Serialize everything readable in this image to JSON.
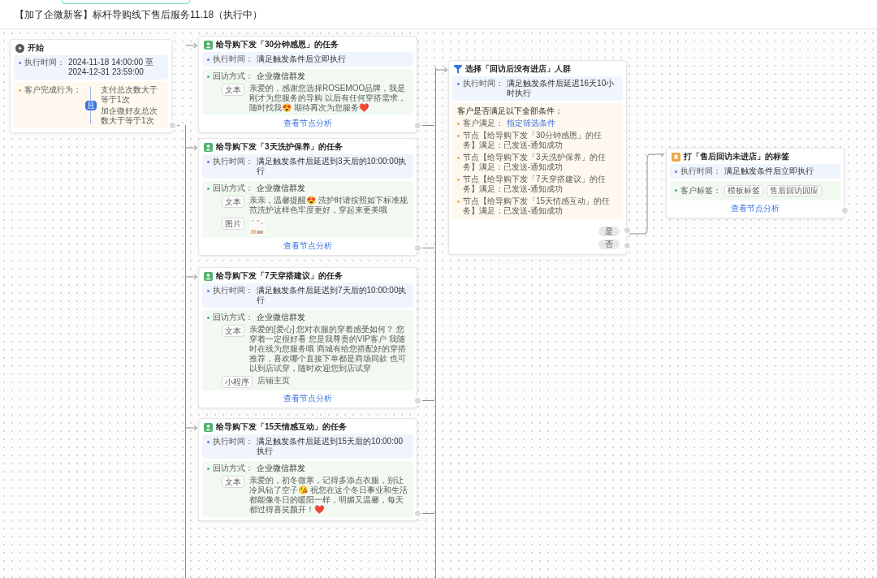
{
  "title": "【加了企微新客】标杆导购线下售后服务11.18（执行中）",
  "start": {
    "title": "开始",
    "exec_label": "执行时间：",
    "exec_value": "2024-11-18 14:00:00 至 2024-12-31 23:59:00",
    "behavior_label": "客户完成行为：",
    "logic": "且",
    "conditions": [
      "支付总次数大于等于1次",
      "加企微好友总次数大于等于1次"
    ]
  },
  "tasks": [
    {
      "title": "给导购下发「30分钟感恩」的任务",
      "exec_label": "执行时间：",
      "exec_value": "满足触发条件后立即执行",
      "method_label": "回访方式：",
      "method_value": "企业微信群发",
      "contents": [
        {
          "kind": "text",
          "label": "文本",
          "value": "亲爱的，感谢您选择ROSEMOO品牌，我是刚才为您服务的导购 以后有任何穿搭需求，随时找我😍 期待再次为您服务❤️"
        }
      ],
      "link": "查看节点分析"
    },
    {
      "title": "给导购下发「3天洗护保养」的任务",
      "exec_label": "执行时间：",
      "exec_value": "满足触发条件后延迟到3天后的10:00:00执行",
      "method_label": "回访方式：",
      "method_value": "企业微信群发",
      "contents": [
        {
          "kind": "text",
          "label": "文本",
          "value": "亲亲，温馨提醒😍 洗护时请按照如下标准规范洗护这样色牢度更好，穿起来更美哦"
        },
        {
          "label": "图片"
        }
      ],
      "link": "查看节点分析"
    },
    {
      "title": "给导购下发「7天穿搭建议」的任务",
      "exec_label": "执行时间：",
      "exec_value": "满足触发条件后延迟到7天后的10:00:00执行",
      "method_label": "回访方式：",
      "method_value": "企业微信群发",
      "contents": [
        {
          "kind": "text",
          "label": "文本",
          "value": "亲爱的[爱心] 您对衣服的穿着感受如何？ 您穿着一定很好看 您是我尊贵的VIP客户 我随时在线为您服务哦 商城有给您搭配好的穿搭推荐，喜欢哪个直接下单都是商场同款 也可以到店试穿，随时欢迎您到店试穿"
        },
        {
          "kind": "text",
          "label": "小程序",
          "value": "店铺主页"
        }
      ],
      "link": "查看节点分析"
    },
    {
      "title": "给导购下发「15天情感互动」的任务",
      "exec_label": "执行时间：",
      "exec_value": "满足触发条件后延迟到15天后的10:00:00执行",
      "method_label": "回访方式：",
      "method_value": "企业微信群发",
      "contents": [
        {
          "kind": "text",
          "label": "文本",
          "value": "亲爱的，初冬微寒，记得多添点衣服，别让冷风钻了空子😘 祝您在这个冬日事业和生活都能像冬日的暖阳一样，明媚又温馨，每天都过得喜笑颜开！❤️"
        }
      ]
    }
  ],
  "filter": {
    "title": "选择「回访后没有进店」人群",
    "exec_label": "执行时间：",
    "exec_value": "满足触发条件后延迟16天10小时执行",
    "cond_title": "客户是否满足以下全部条件：",
    "items": [
      {
        "kind": "link",
        "text": "客户满足：",
        "link": "指定筛选条件"
      },
      {
        "kind": "plain",
        "text": "节点【给导购下发「30分钟感恩」的任务】满足：已发送-通知成功"
      },
      {
        "kind": "plain",
        "text": "节点【给导购下发「3天洗护保养」的任务】满足：已发送-通知成功"
      },
      {
        "kind": "plain",
        "text": "节点【给导购下发「7天穿搭建议」的任务】满足：已发送-通知成功"
      },
      {
        "kind": "plain",
        "text": "节点【给导购下发「15天情感互动」的任务】满足：已发送-通知成功"
      }
    ],
    "branches": [
      "是",
      "否"
    ]
  },
  "tag": {
    "title": "打「售后回访未进店」的标签",
    "exec_label": "执行时间：",
    "exec_value": "满足触发条件后立即执行",
    "tag_label": "客户标签：",
    "tags": [
      "模板标签",
      "售后回访回应"
    ],
    "link": "查看节点分析"
  }
}
